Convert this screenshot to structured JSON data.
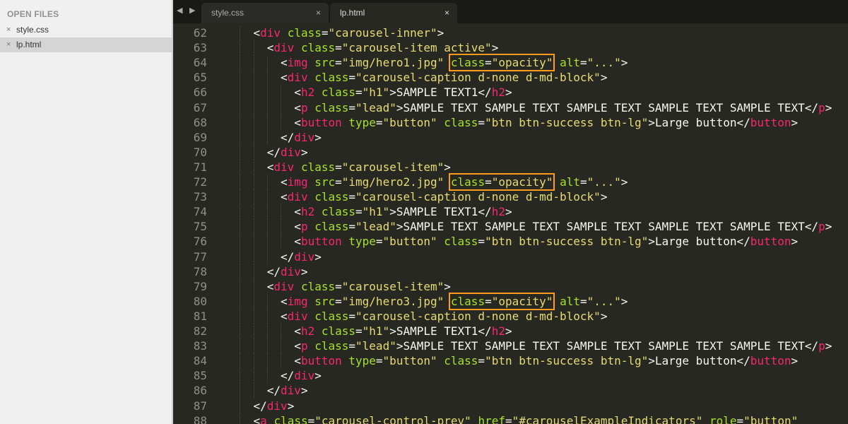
{
  "sidebar": {
    "header": "OPEN FILES",
    "files": [
      {
        "close": "×",
        "name": "style.css",
        "selected": false
      },
      {
        "close": "×",
        "name": "lp.html",
        "selected": true
      }
    ]
  },
  "tabbar": {
    "nav_arrows": "◀ ▶",
    "tabs": [
      {
        "label": "style.css",
        "close": "×",
        "active": false
      },
      {
        "label": "lp.html",
        "close": "×",
        "active": true
      }
    ]
  },
  "colors": {
    "background": "#272822",
    "tag": "#f92672",
    "attribute": "#a6e22e",
    "string": "#e6db74",
    "text": "#f8f8f2",
    "line_number": "#8f908a",
    "highlight_box": "#ff9a1f"
  },
  "editor": {
    "lines": [
      {
        "num": "62",
        "indent": 4,
        "tokens": [
          [
            "p",
            "<"
          ],
          [
            "t",
            "div"
          ],
          [
            "p",
            " "
          ],
          [
            "a",
            "class"
          ],
          [
            "p",
            "="
          ],
          [
            "s",
            "\"carousel-inner\""
          ],
          [
            "p",
            ">"
          ]
        ]
      },
      {
        "num": "63",
        "indent": 6,
        "tokens": [
          [
            "p",
            "<"
          ],
          [
            "t",
            "div"
          ],
          [
            "p",
            " "
          ],
          [
            "a",
            "class"
          ],
          [
            "p",
            "="
          ],
          [
            "s",
            "\"carousel-item active\""
          ],
          [
            "p",
            ">"
          ]
        ]
      },
      {
        "num": "64",
        "indent": 8,
        "tokens": [
          [
            "p",
            "<"
          ],
          [
            "t",
            "img"
          ],
          [
            "p",
            " "
          ],
          [
            "a",
            "src"
          ],
          [
            "p",
            "="
          ],
          [
            "s",
            "\"img/hero1.jpg\""
          ],
          [
            "p",
            " "
          ],
          [
            "h",
            "class",
            "=",
            "\"opacity\""
          ],
          [
            "p",
            " "
          ],
          [
            "a",
            "alt"
          ],
          [
            "p",
            "="
          ],
          [
            "s",
            "\"...\""
          ],
          [
            "p",
            ">"
          ]
        ]
      },
      {
        "num": "65",
        "indent": 8,
        "tokens": [
          [
            "p",
            "<"
          ],
          [
            "t",
            "div"
          ],
          [
            "p",
            " "
          ],
          [
            "a",
            "class"
          ],
          [
            "p",
            "="
          ],
          [
            "s",
            "\"carousel-caption d-none d-md-block\""
          ],
          [
            "p",
            ">"
          ]
        ]
      },
      {
        "num": "66",
        "indent": 10,
        "tokens": [
          [
            "p",
            "<"
          ],
          [
            "t",
            "h2"
          ],
          [
            "p",
            " "
          ],
          [
            "a",
            "class"
          ],
          [
            "p",
            "="
          ],
          [
            "s",
            "\"h1\""
          ],
          [
            "p",
            ">SAMPLE TEXT1</"
          ],
          [
            "t",
            "h2"
          ],
          [
            "p",
            ">"
          ]
        ]
      },
      {
        "num": "67",
        "indent": 10,
        "tokens": [
          [
            "p",
            "<"
          ],
          [
            "t",
            "p"
          ],
          [
            "p",
            " "
          ],
          [
            "a",
            "class"
          ],
          [
            "p",
            "="
          ],
          [
            "s",
            "\"lead\""
          ],
          [
            "p",
            ">SAMPLE TEXT SAMPLE TEXT SAMPLE TEXT SAMPLE TEXT SAMPLE TEXT</"
          ],
          [
            "t",
            "p"
          ],
          [
            "p",
            ">"
          ]
        ]
      },
      {
        "num": "68",
        "indent": 10,
        "tokens": [
          [
            "p",
            "<"
          ],
          [
            "t",
            "button"
          ],
          [
            "p",
            " "
          ],
          [
            "a",
            "type"
          ],
          [
            "p",
            "="
          ],
          [
            "s",
            "\"button\""
          ],
          [
            "p",
            " "
          ],
          [
            "a",
            "class"
          ],
          [
            "p",
            "="
          ],
          [
            "s",
            "\"btn btn-success btn-lg\""
          ],
          [
            "p",
            ">Large button</"
          ],
          [
            "t",
            "button"
          ],
          [
            "p",
            ">"
          ]
        ]
      },
      {
        "num": "69",
        "indent": 8,
        "tokens": [
          [
            "p",
            "</"
          ],
          [
            "t",
            "div"
          ],
          [
            "p",
            ">"
          ]
        ]
      },
      {
        "num": "70",
        "indent": 6,
        "tokens": [
          [
            "p",
            "</"
          ],
          [
            "t",
            "div"
          ],
          [
            "p",
            ">"
          ]
        ]
      },
      {
        "num": "71",
        "indent": 6,
        "tokens": [
          [
            "p",
            "<"
          ],
          [
            "t",
            "div"
          ],
          [
            "p",
            " "
          ],
          [
            "a",
            "class"
          ],
          [
            "p",
            "="
          ],
          [
            "s",
            "\"carousel-item\""
          ],
          [
            "p",
            ">"
          ]
        ]
      },
      {
        "num": "72",
        "indent": 8,
        "tokens": [
          [
            "p",
            "<"
          ],
          [
            "t",
            "img"
          ],
          [
            "p",
            " "
          ],
          [
            "a",
            "src"
          ],
          [
            "p",
            "="
          ],
          [
            "s",
            "\"img/hero2.jpg\""
          ],
          [
            "p",
            " "
          ],
          [
            "h",
            "class",
            "=",
            "\"opacity\""
          ],
          [
            "p",
            " "
          ],
          [
            "a",
            "alt"
          ],
          [
            "p",
            "="
          ],
          [
            "s",
            "\"...\""
          ],
          [
            "p",
            ">"
          ]
        ]
      },
      {
        "num": "73",
        "indent": 8,
        "tokens": [
          [
            "p",
            "<"
          ],
          [
            "t",
            "div"
          ],
          [
            "p",
            " "
          ],
          [
            "a",
            "class"
          ],
          [
            "p",
            "="
          ],
          [
            "s",
            "\"carousel-caption d-none d-md-block\""
          ],
          [
            "p",
            ">"
          ]
        ]
      },
      {
        "num": "74",
        "indent": 10,
        "tokens": [
          [
            "p",
            "<"
          ],
          [
            "t",
            "h2"
          ],
          [
            "p",
            " "
          ],
          [
            "a",
            "class"
          ],
          [
            "p",
            "="
          ],
          [
            "s",
            "\"h1\""
          ],
          [
            "p",
            ">SAMPLE TEXT1</"
          ],
          [
            "t",
            "h2"
          ],
          [
            "p",
            ">"
          ]
        ]
      },
      {
        "num": "75",
        "indent": 10,
        "tokens": [
          [
            "p",
            "<"
          ],
          [
            "t",
            "p"
          ],
          [
            "p",
            " "
          ],
          [
            "a",
            "class"
          ],
          [
            "p",
            "="
          ],
          [
            "s",
            "\"lead\""
          ],
          [
            "p",
            ">SAMPLE TEXT SAMPLE TEXT SAMPLE TEXT SAMPLE TEXT SAMPLE TEXT</"
          ],
          [
            "t",
            "p"
          ],
          [
            "p",
            ">"
          ]
        ]
      },
      {
        "num": "76",
        "indent": 10,
        "tokens": [
          [
            "p",
            "<"
          ],
          [
            "t",
            "button"
          ],
          [
            "p",
            " "
          ],
          [
            "a",
            "type"
          ],
          [
            "p",
            "="
          ],
          [
            "s",
            "\"button\""
          ],
          [
            "p",
            " "
          ],
          [
            "a",
            "class"
          ],
          [
            "p",
            "="
          ],
          [
            "s",
            "\"btn btn-success btn-lg\""
          ],
          [
            "p",
            ">Large button</"
          ],
          [
            "t",
            "button"
          ],
          [
            "p",
            ">"
          ]
        ]
      },
      {
        "num": "77",
        "indent": 8,
        "tokens": [
          [
            "p",
            "</"
          ],
          [
            "t",
            "div"
          ],
          [
            "p",
            ">"
          ]
        ]
      },
      {
        "num": "78",
        "indent": 6,
        "tokens": [
          [
            "p",
            "</"
          ],
          [
            "t",
            "div"
          ],
          [
            "p",
            ">"
          ]
        ]
      },
      {
        "num": "79",
        "indent": 6,
        "tokens": [
          [
            "p",
            "<"
          ],
          [
            "t",
            "div"
          ],
          [
            "p",
            " "
          ],
          [
            "a",
            "class"
          ],
          [
            "p",
            "="
          ],
          [
            "s",
            "\"carousel-item\""
          ],
          [
            "p",
            ">"
          ]
        ]
      },
      {
        "num": "80",
        "indent": 8,
        "tokens": [
          [
            "p",
            "<"
          ],
          [
            "t",
            "img"
          ],
          [
            "p",
            " "
          ],
          [
            "a",
            "src"
          ],
          [
            "p",
            "="
          ],
          [
            "s",
            "\"img/hero3.jpg\""
          ],
          [
            "p",
            " "
          ],
          [
            "h",
            "class",
            "=",
            "\"opacity\""
          ],
          [
            "p",
            " "
          ],
          [
            "a",
            "alt"
          ],
          [
            "p",
            "="
          ],
          [
            "s",
            "\"...\""
          ],
          [
            "p",
            ">"
          ]
        ]
      },
      {
        "num": "81",
        "indent": 8,
        "tokens": [
          [
            "p",
            "<"
          ],
          [
            "t",
            "div"
          ],
          [
            "p",
            " "
          ],
          [
            "a",
            "class"
          ],
          [
            "p",
            "="
          ],
          [
            "s",
            "\"carousel-caption d-none d-md-block\""
          ],
          [
            "p",
            ">"
          ]
        ]
      },
      {
        "num": "82",
        "indent": 10,
        "tokens": [
          [
            "p",
            "<"
          ],
          [
            "t",
            "h2"
          ],
          [
            "p",
            " "
          ],
          [
            "a",
            "class"
          ],
          [
            "p",
            "="
          ],
          [
            "s",
            "\"h1\""
          ],
          [
            "p",
            ">SAMPLE TEXT1</"
          ],
          [
            "t",
            "h2"
          ],
          [
            "p",
            ">"
          ]
        ]
      },
      {
        "num": "83",
        "indent": 10,
        "tokens": [
          [
            "p",
            "<"
          ],
          [
            "t",
            "p"
          ],
          [
            "p",
            " "
          ],
          [
            "a",
            "class"
          ],
          [
            "p",
            "="
          ],
          [
            "s",
            "\"lead\""
          ],
          [
            "p",
            ">SAMPLE TEXT SAMPLE TEXT SAMPLE TEXT SAMPLE TEXT SAMPLE TEXT</"
          ],
          [
            "t",
            "p"
          ],
          [
            "p",
            ">"
          ]
        ]
      },
      {
        "num": "84",
        "indent": 10,
        "tokens": [
          [
            "p",
            "<"
          ],
          [
            "t",
            "button"
          ],
          [
            "p",
            " "
          ],
          [
            "a",
            "type"
          ],
          [
            "p",
            "="
          ],
          [
            "s",
            "\"button\""
          ],
          [
            "p",
            " "
          ],
          [
            "a",
            "class"
          ],
          [
            "p",
            "="
          ],
          [
            "s",
            "\"btn btn-success btn-lg\""
          ],
          [
            "p",
            ">Large button</"
          ],
          [
            "t",
            "button"
          ],
          [
            "p",
            ">"
          ]
        ]
      },
      {
        "num": "85",
        "indent": 8,
        "tokens": [
          [
            "p",
            "</"
          ],
          [
            "t",
            "div"
          ],
          [
            "p",
            ">"
          ]
        ]
      },
      {
        "num": "86",
        "indent": 6,
        "tokens": [
          [
            "p",
            "</"
          ],
          [
            "t",
            "div"
          ],
          [
            "p",
            ">"
          ]
        ]
      },
      {
        "num": "87",
        "indent": 4,
        "tokens": [
          [
            "p",
            "</"
          ],
          [
            "t",
            "div"
          ],
          [
            "p",
            ">"
          ]
        ]
      },
      {
        "num": "88",
        "indent": 4,
        "tokens": [
          [
            "p",
            "<"
          ],
          [
            "t",
            "a"
          ],
          [
            "p",
            " "
          ],
          [
            "a",
            "class"
          ],
          [
            "p",
            "="
          ],
          [
            "s",
            "\"carousel-control-prev\""
          ],
          [
            "p",
            " "
          ],
          [
            "a",
            "href"
          ],
          [
            "p",
            "="
          ],
          [
            "s",
            "\"#carouselExampleIndicators\""
          ],
          [
            "p",
            " "
          ],
          [
            "a",
            "role"
          ],
          [
            "p",
            "="
          ],
          [
            "s",
            "\"button\""
          ]
        ]
      }
    ]
  }
}
